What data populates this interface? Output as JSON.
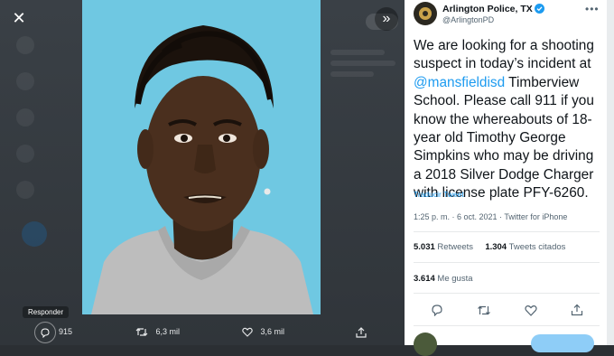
{
  "viewer": {
    "close_icon": "close-icon",
    "expand_icon": "double-chevron-right-icon"
  },
  "photo": {
    "subject": "mugshot"
  },
  "actions": {
    "tooltip": "Responder",
    "reply_count": "915",
    "retweet_count": "6,3 mil",
    "like_count": "3,6 mil"
  },
  "tweet": {
    "author_name": "Arlington Police, TX",
    "handle": "@ArlingtonPD",
    "text_before": "We are looking for a shooting suspect in today’s incident at ",
    "mention": "@mansfieldisd",
    "text_after": " Timberview School. Please call 911 if you know the whereabouts of 18-year old Timothy George Simpkins who may be driving a 2018 Silver Dodge Charger with license plate PFY-6260.",
    "translate_label": "Traducir Tweet",
    "meta": "1:25 p. m. · 6 oct. 2021 · Twitter for iPhone",
    "retweets_value": "5.031",
    "retweets_label": "Retweets",
    "quotes_value": "1.304",
    "quotes_label": "Tweets citados",
    "likes_value": "3.614",
    "likes_label": "Me gusta"
  },
  "colors": {
    "link": "#1d9bf0",
    "photo_bg": "#6fc8e2",
    "overlay": "#34393e"
  }
}
